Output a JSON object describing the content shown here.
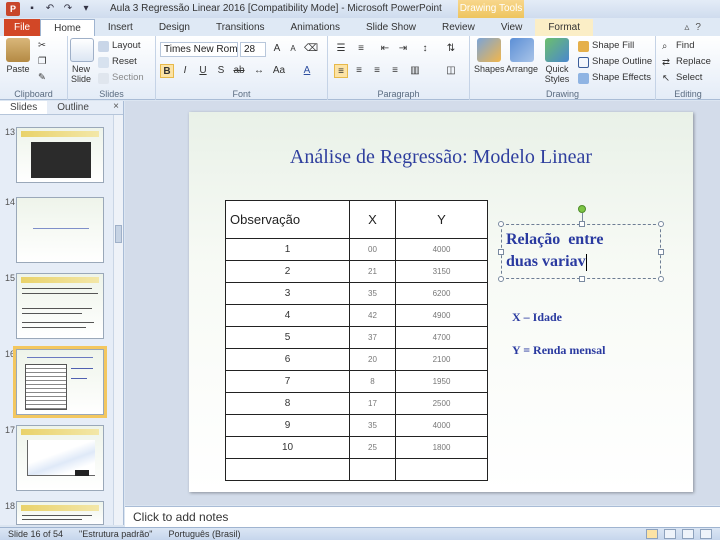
{
  "window": {
    "title": "Aula 3 Regressão Linear 2016 [Compatibility Mode] - Microsoft PowerPoint",
    "context_header": "Drawing Tools",
    "app_icon": "P"
  },
  "tabs": [
    "File",
    "Home",
    "Insert",
    "Design",
    "Transitions",
    "Animations",
    "Slide Show",
    "Review",
    "View",
    "Format"
  ],
  "ribbon": {
    "clipboard": {
      "paste": "Paste",
      "label": "Clipboard"
    },
    "slides": {
      "new_slide": "New Slide",
      "layout": "Layout",
      "reset": "Reset",
      "section": "Section",
      "label": "Slides"
    },
    "font": {
      "font_name": "Times New Roman",
      "font_size": "28",
      "label": "Font"
    },
    "paragraph": {
      "label": "Paragraph"
    },
    "drawing": {
      "shapes": "Shapes",
      "arrange": "Arrange",
      "quick_styles": "Quick Styles",
      "shape_fill": "Shape Fill",
      "shape_outline": "Shape Outline",
      "shape_effects": "Shape Effects",
      "label": "Drawing"
    },
    "editing": {
      "find": "Find",
      "replace": "Replace",
      "select": "Select",
      "label": "Editing"
    }
  },
  "panel": {
    "tab_slides": "Slides",
    "tab_outline": "Outline",
    "thumb_numbers": [
      "13",
      "14",
      "15",
      "16",
      "17",
      "18"
    ]
  },
  "slide": {
    "title": "Análise de Regressão: Modelo Linear",
    "table": {
      "headers": [
        "Observação",
        "X",
        "Y"
      ],
      "rows": [
        [
          "1",
          "00",
          "4000"
        ],
        [
          "2",
          "21",
          "3150"
        ],
        [
          "3",
          "35",
          "6200"
        ],
        [
          "4",
          "42",
          "4900"
        ],
        [
          "5",
          "37",
          "4700"
        ],
        [
          "6",
          "20",
          "2100"
        ],
        [
          "7",
          "8",
          "1950"
        ],
        [
          "8",
          "17",
          "2500"
        ],
        [
          "9",
          "35",
          "4000"
        ],
        [
          "10",
          "25",
          "1800"
        ],
        [
          "",
          "",
          ""
        ]
      ]
    },
    "textbox_line1": "Relação  entre",
    "textbox_line2": "duas variav",
    "var_x": "X – Idade",
    "var_y": "Y = Renda mensal"
  },
  "notes_placeholder": "Click to add notes",
  "status": {
    "slide_info": "Slide 16 of 54",
    "theme": "\"Estrutura padrão\"",
    "language": "Português (Brasil)"
  }
}
